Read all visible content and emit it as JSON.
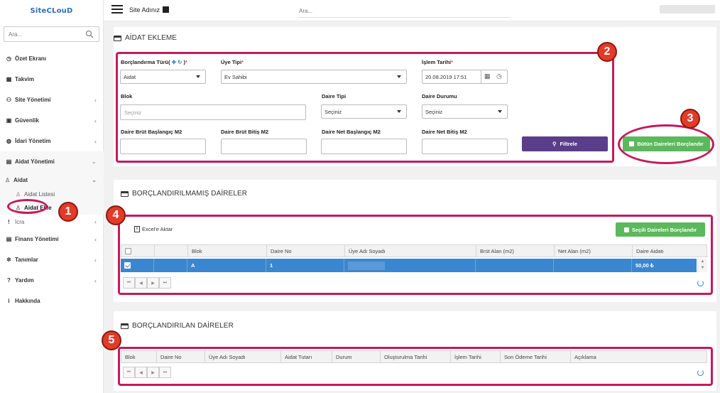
{
  "brand": {
    "logo_text": "SiteCLouD"
  },
  "sidebar": {
    "search_placeholder": "Ara...",
    "items": [
      {
        "label": "Özet Ekranı",
        "icon": "dashboard-icon",
        "glyph": "◷"
      },
      {
        "label": "Takvim",
        "icon": "calendar-icon",
        "glyph": "▦"
      },
      {
        "label": "Site Yönetimi",
        "icon": "users-icon",
        "glyph": "⚇",
        "chevron": "‹"
      },
      {
        "label": "Güvenlik",
        "icon": "lock-icon",
        "glyph": "▣",
        "chevron": "‹"
      },
      {
        "label": "İdari Yönetim",
        "icon": "globe-icon",
        "glyph": "◍",
        "chevron": "‹"
      },
      {
        "label": "Aidat Yönetimi",
        "icon": "money-icon",
        "glyph": "▤",
        "chevron": "⌄"
      }
    ],
    "aidat_group": "Aidat",
    "aidat_group_chevron": "⌄",
    "aidat_sub": [
      "Aidat Listesi",
      "Aidat Ekle"
    ],
    "items_after": [
      {
        "label": "İcra",
        "icon": "exclamation-icon",
        "glyph": "!",
        "chevron": "‹"
      },
      {
        "label": "Finans Yönetimi",
        "icon": "finance-icon",
        "glyph": "▤",
        "chevron": "‹"
      },
      {
        "label": "Tanımlar",
        "icon": "gear-icon",
        "glyph": "✲",
        "chevron": "‹"
      },
      {
        "label": "Yardım",
        "icon": "question-icon",
        "glyph": "?",
        "chevron": "‹"
      },
      {
        "label": "Hakkında",
        "icon": "info-icon",
        "glyph": "i"
      }
    ]
  },
  "topbar": {
    "site_name": "Site Adınız",
    "search_placeholder": "Ara..."
  },
  "aidat_ekleme": {
    "title": "AİDAT EKLEME",
    "borc_turu_label": "Borçlandırma Türü(",
    "borc_turu_close": ")",
    "borc_turu_value": "Aidat",
    "uye_tipi_label": "Üye Tipi",
    "uye_tipi_value": "Ev Sahibi",
    "islem_tarihi_label": "İşlem Tarihi",
    "islem_tarihi_value": "20.08.2019 17:51",
    "blok_label": "Blok",
    "blok_placeholder": "Seçiniz",
    "daire_tipi_label": "Daire Tipi",
    "daire_tipi_value": "Seçiniz",
    "daire_durumu_label": "Daire Durumu",
    "daire_durumu_value": "Seçiniz",
    "brut_bas_label": "Daire Brüt Başlangıç M2",
    "brut_bit_label": "Daire Brüt Bitiş M2",
    "net_bas_label": "Daire Net Başlangıç M2",
    "net_bit_label": "Daire Net Bitiş M2",
    "filter_button": "Filtrele",
    "all_button": "Bütün Daireleri Borçlandır"
  },
  "unassigned": {
    "title": "BORÇLANDIRILMAMIŞ DAİRELER",
    "excel_label": "Excel'e Aktar",
    "assign_button": "Seçili Daireleri Borçlandır",
    "columns": [
      "",
      "",
      "Blok",
      "Daire No",
      "Üye Adı Soyadı",
      "Brüt Alan (m2)",
      "Net Alan (m2)",
      "Daire Aidatı"
    ],
    "rows": [
      {
        "blok": "A",
        "daire_no": "1",
        "uye": "",
        "brut": "",
        "net": "",
        "aidat": "50,00 ₺"
      }
    ]
  },
  "assigned": {
    "title": "BORÇLANDIRILAN DAİRELER",
    "columns": [
      "Blok",
      "Daire No",
      "Üye Adı Soyadı",
      "Aidat Tutarı",
      "Durum",
      "Oluşturulma Tarihi",
      "İşlem Tarihi",
      "Son Ödeme Tarihi",
      "Açıklama"
    ]
  },
  "pager_glyphs": [
    "⏮",
    "◀",
    "▶",
    "⏭"
  ],
  "annotations": [
    "1",
    "2",
    "3",
    "4",
    "5"
  ],
  "colors": {
    "annotation": "#c6195b",
    "badge": "#e23b28",
    "primary": "#3a87cf",
    "filter": "#5b3e8a",
    "success": "#5cb85c"
  }
}
